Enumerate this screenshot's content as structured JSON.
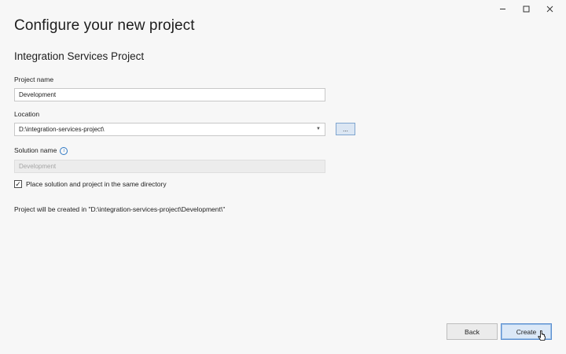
{
  "window": {
    "controls": [
      "minimize-icon",
      "maximize-icon",
      "close-icon"
    ]
  },
  "header": {
    "title": "Configure your new project",
    "subtitle": "Integration Services Project"
  },
  "form": {
    "project_name_label": "Project name",
    "project_name_value": "Development",
    "location_label": "Location",
    "location_value": "D:\\integration-services-project\\",
    "browse_label": "...",
    "solution_name_label": "Solution name",
    "solution_name_placeholder": "Development",
    "same_directory_checked": true,
    "same_directory_label": "Place solution and project in the same directory",
    "summary": "Project will be created in \"D:\\integration-services-project\\Development\\\""
  },
  "footer": {
    "back_label": "Back",
    "create_label": "Create"
  },
  "colors": {
    "background": "#f7f7f7",
    "accent": "#5b8fd0",
    "primary_button_bg": "#dbe8f7"
  }
}
